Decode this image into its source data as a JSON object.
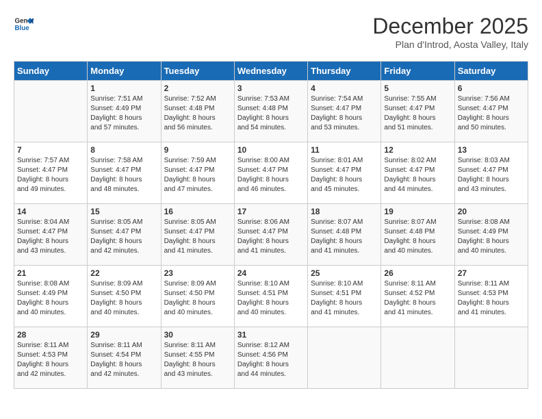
{
  "header": {
    "logo_line1": "General",
    "logo_line2": "Blue",
    "month_title": "December 2025",
    "location": "Plan d'Introd, Aosta Valley, Italy"
  },
  "days_of_week": [
    "Sunday",
    "Monday",
    "Tuesday",
    "Wednesday",
    "Thursday",
    "Friday",
    "Saturday"
  ],
  "weeks": [
    [
      {
        "day": "",
        "info": ""
      },
      {
        "day": "1",
        "info": "Sunrise: 7:51 AM\nSunset: 4:49 PM\nDaylight: 8 hours\nand 57 minutes."
      },
      {
        "day": "2",
        "info": "Sunrise: 7:52 AM\nSunset: 4:48 PM\nDaylight: 8 hours\nand 56 minutes."
      },
      {
        "day": "3",
        "info": "Sunrise: 7:53 AM\nSunset: 4:48 PM\nDaylight: 8 hours\nand 54 minutes."
      },
      {
        "day": "4",
        "info": "Sunrise: 7:54 AM\nSunset: 4:47 PM\nDaylight: 8 hours\nand 53 minutes."
      },
      {
        "day": "5",
        "info": "Sunrise: 7:55 AM\nSunset: 4:47 PM\nDaylight: 8 hours\nand 51 minutes."
      },
      {
        "day": "6",
        "info": "Sunrise: 7:56 AM\nSunset: 4:47 PM\nDaylight: 8 hours\nand 50 minutes."
      }
    ],
    [
      {
        "day": "7",
        "info": "Sunrise: 7:57 AM\nSunset: 4:47 PM\nDaylight: 8 hours\nand 49 minutes."
      },
      {
        "day": "8",
        "info": "Sunrise: 7:58 AM\nSunset: 4:47 PM\nDaylight: 8 hours\nand 48 minutes."
      },
      {
        "day": "9",
        "info": "Sunrise: 7:59 AM\nSunset: 4:47 PM\nDaylight: 8 hours\nand 47 minutes."
      },
      {
        "day": "10",
        "info": "Sunrise: 8:00 AM\nSunset: 4:47 PM\nDaylight: 8 hours\nand 46 minutes."
      },
      {
        "day": "11",
        "info": "Sunrise: 8:01 AM\nSunset: 4:47 PM\nDaylight: 8 hours\nand 45 minutes."
      },
      {
        "day": "12",
        "info": "Sunrise: 8:02 AM\nSunset: 4:47 PM\nDaylight: 8 hours\nand 44 minutes."
      },
      {
        "day": "13",
        "info": "Sunrise: 8:03 AM\nSunset: 4:47 PM\nDaylight: 8 hours\nand 43 minutes."
      }
    ],
    [
      {
        "day": "14",
        "info": "Sunrise: 8:04 AM\nSunset: 4:47 PM\nDaylight: 8 hours\nand 43 minutes."
      },
      {
        "day": "15",
        "info": "Sunrise: 8:05 AM\nSunset: 4:47 PM\nDaylight: 8 hours\nand 42 minutes."
      },
      {
        "day": "16",
        "info": "Sunrise: 8:05 AM\nSunset: 4:47 PM\nDaylight: 8 hours\nand 41 minutes."
      },
      {
        "day": "17",
        "info": "Sunrise: 8:06 AM\nSunset: 4:47 PM\nDaylight: 8 hours\nand 41 minutes."
      },
      {
        "day": "18",
        "info": "Sunrise: 8:07 AM\nSunset: 4:48 PM\nDaylight: 8 hours\nand 41 minutes."
      },
      {
        "day": "19",
        "info": "Sunrise: 8:07 AM\nSunset: 4:48 PM\nDaylight: 8 hours\nand 40 minutes."
      },
      {
        "day": "20",
        "info": "Sunrise: 8:08 AM\nSunset: 4:49 PM\nDaylight: 8 hours\nand 40 minutes."
      }
    ],
    [
      {
        "day": "21",
        "info": "Sunrise: 8:08 AM\nSunset: 4:49 PM\nDaylight: 8 hours\nand 40 minutes."
      },
      {
        "day": "22",
        "info": "Sunrise: 8:09 AM\nSunset: 4:50 PM\nDaylight: 8 hours\nand 40 minutes."
      },
      {
        "day": "23",
        "info": "Sunrise: 8:09 AM\nSunset: 4:50 PM\nDaylight: 8 hours\nand 40 minutes."
      },
      {
        "day": "24",
        "info": "Sunrise: 8:10 AM\nSunset: 4:51 PM\nDaylight: 8 hours\nand 40 minutes."
      },
      {
        "day": "25",
        "info": "Sunrise: 8:10 AM\nSunset: 4:51 PM\nDaylight: 8 hours\nand 41 minutes."
      },
      {
        "day": "26",
        "info": "Sunrise: 8:11 AM\nSunset: 4:52 PM\nDaylight: 8 hours\nand 41 minutes."
      },
      {
        "day": "27",
        "info": "Sunrise: 8:11 AM\nSunset: 4:53 PM\nDaylight: 8 hours\nand 41 minutes."
      }
    ],
    [
      {
        "day": "28",
        "info": "Sunrise: 8:11 AM\nSunset: 4:53 PM\nDaylight: 8 hours\nand 42 minutes."
      },
      {
        "day": "29",
        "info": "Sunrise: 8:11 AM\nSunset: 4:54 PM\nDaylight: 8 hours\nand 42 minutes."
      },
      {
        "day": "30",
        "info": "Sunrise: 8:11 AM\nSunset: 4:55 PM\nDaylight: 8 hours\nand 43 minutes."
      },
      {
        "day": "31",
        "info": "Sunrise: 8:12 AM\nSunset: 4:56 PM\nDaylight: 8 hours\nand 44 minutes."
      },
      {
        "day": "",
        "info": ""
      },
      {
        "day": "",
        "info": ""
      },
      {
        "day": "",
        "info": ""
      }
    ]
  ]
}
